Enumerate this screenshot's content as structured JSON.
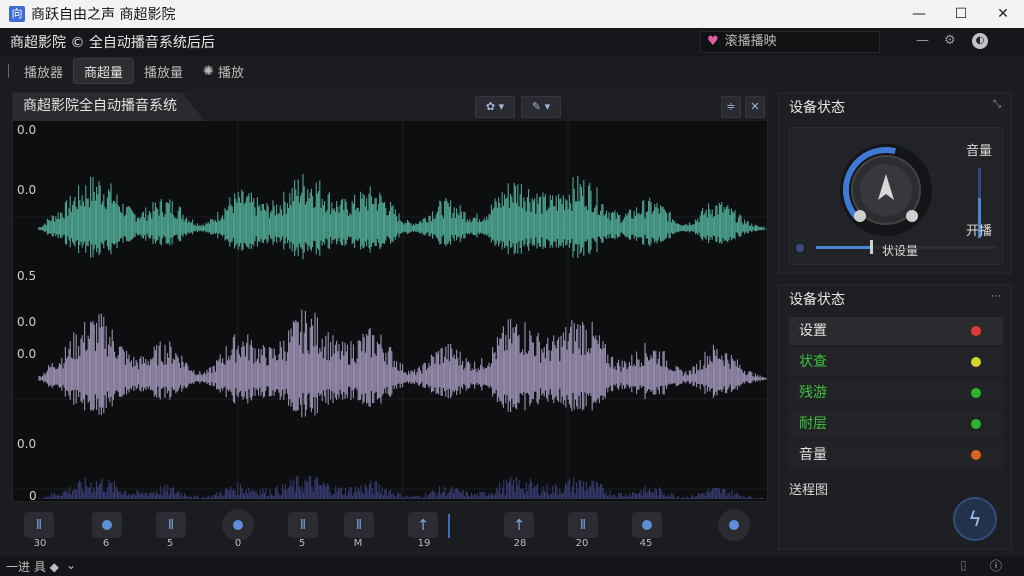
{
  "window": {
    "title": "商跃自由之声 商超影院",
    "icon_glyph": "向",
    "minimize": "—",
    "maximize": "☐",
    "close": "✕"
  },
  "menubar": {
    "app_title": "商超影院 © 全自动播音系统后后",
    "search_text": "滚播播映",
    "heart": "♥"
  },
  "tabs": [
    "播放器",
    "商超量",
    "播放量",
    "播放"
  ],
  "active_tab": 1,
  "panel": {
    "title": "商超影院全自动播音系统",
    "ylabels": [
      "0.0",
      "0.0",
      "0.5",
      "0.0",
      "0.0",
      "0.0",
      "0"
    ],
    "btn1": "✿ ▾",
    "btn2": "✎ ▾",
    "btn3": "≑",
    "btn4": "✕"
  },
  "transport": {
    "labels": [
      "30",
      "6",
      "5",
      "0",
      "5",
      "M",
      "19",
      "28",
      "20",
      "45"
    ]
  },
  "device_panel": {
    "title": "设备状态",
    "volume_label": "音量",
    "switch_label": "开播",
    "slider_label": "状设量",
    "volume_level": 0.55
  },
  "status_panel": {
    "title": "设备状态",
    "rows": [
      {
        "label": "设置",
        "color": "#e03838"
      },
      {
        "label": "状查",
        "color": "#d4d42a"
      },
      {
        "label": "残游",
        "color": "#2ab82a"
      },
      {
        "label": "耐层",
        "color": "#2ab82a"
      },
      {
        "label": "音量",
        "color": "#d8641e"
      }
    ],
    "footer_label": "送程图"
  },
  "statusbar": {
    "left_text": "一进 具 ◆",
    "chevron": "⌄"
  },
  "colors": {
    "wave_top": "#4fa593",
    "wave_mid": "#9a90b0",
    "wave_bot": "#3c3f7a",
    "accent": "#4a86d6"
  }
}
